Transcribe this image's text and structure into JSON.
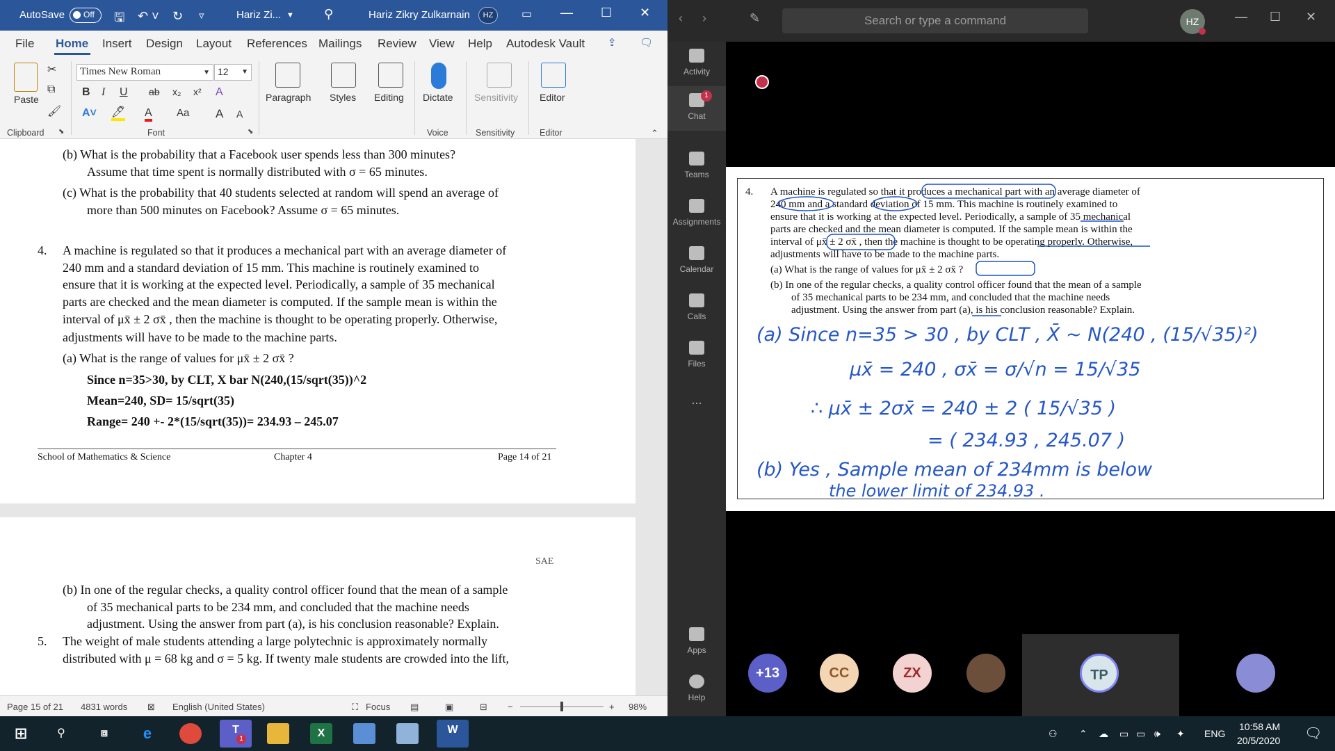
{
  "word": {
    "titlebar": {
      "autosave": "AutoSave",
      "autosave_state": "Off",
      "doc_title": "Hariz Zi...",
      "user_name": "Hariz Zikry Zulkarnain",
      "user_initials": "HZ"
    },
    "menu": [
      "File",
      "Home",
      "Insert",
      "Design",
      "Layout",
      "References",
      "Mailings",
      "Review",
      "View",
      "Help",
      "Autodesk Vault"
    ],
    "ribbon": {
      "paste": "Paste",
      "font_name": "Times New Roman",
      "font_size": "12",
      "paragraph": "Paragraph",
      "styles": "Styles",
      "editing": "Editing",
      "dictate": "Dictate",
      "sensitivity": "Sensitivity",
      "editor": "Editor",
      "group_clipboard": "Clipboard",
      "group_font": "Font",
      "group_voice": "Voice",
      "group_sensitivity": "Sensitivity",
      "group_editor": "Editor",
      "font_btns": [
        "B",
        "I",
        "U",
        "ab",
        "x₂",
        "x²",
        "A",
        "Aa",
        "A",
        "A"
      ]
    },
    "page1": {
      "line_b1": "(b)  What is the probability that a Facebook user spends less than 300 minutes?",
      "line_b2": "Assume that time spent is normally distributed with σ = 65 minutes.",
      "line_c1": "(c)  What is the probability that 40 students selected at random will spend an average of",
      "line_c2": "more than 500 minutes on Facebook?  Assume σ = 65 minutes.",
      "q4_num": "4.",
      "q4_lines": [
        "A machine is regulated so that it produces a mechanical part with an average diameter of",
        "240 mm and a standard deviation of 15 mm.  This machine is routinely examined to",
        "ensure that it is working at the expected level.  Periodically, a sample of 35 mechanical",
        "parts are checked and the mean diameter is computed.  If the sample mean is within the",
        "interval of μx̄ ± 2 σx̄ , then the machine is thought to be operating properly.  Otherwise,",
        "adjustments will have to be made to the machine parts."
      ],
      "q4a": "(a)  What is the range of values for μx̄ ± 2 σx̄ ?",
      "ans1": "Since n=35>30, by CLT, X bar N(240,(15/sqrt(35))^2",
      "ans2": "Mean=240, SD= 15/sqrt(35)",
      "ans3": "Range= 240 +- 2*(15/sqrt(35))= 234.93 – 245.07",
      "footer_left": "School of Mathematics & Science",
      "footer_mid": "Chapter 4",
      "footer_right": "Page 14 of 21"
    },
    "page2": {
      "header": "SAE",
      "b_lines": [
        "(b)  In one of the regular checks, a quality control officer found that the mean of a sample",
        "of 35 mechanical parts to be 234 mm, and concluded that the machine needs",
        "adjustment.  Using the answer from part (a), is his conclusion reasonable?  Explain."
      ],
      "q5_num": "5.",
      "q5_lines": [
        "The weight of male students attending a large polytechnic is approximately normally",
        "distributed with μ = 68 kg and σ = 5 kg.  If twenty male students are crowded into the lift,"
      ]
    },
    "status": {
      "page": "Page 15 of 21",
      "words": "4831 words",
      "language": "English (United States)",
      "focus": "Focus",
      "zoom": "98%"
    }
  },
  "teams": {
    "search_placeholder": "Search or type a command",
    "avatar": "HZ",
    "rail": [
      {
        "label": "Activity"
      },
      {
        "label": "Chat",
        "badge": "1"
      },
      {
        "label": "Teams"
      },
      {
        "label": "Assignments"
      },
      {
        "label": "Calendar"
      },
      {
        "label": "Calls"
      },
      {
        "label": "Files"
      },
      {
        "label": "..."
      },
      {
        "label": "Apps"
      },
      {
        "label": "Help"
      }
    ],
    "shared": {
      "q_num": "4.",
      "q_lines": [
        "A machine is regulated so that it produces a mechanical part with an average diameter of",
        "240 mm and a standard deviation of 15 mm.  This machine is routinely examined to",
        "ensure that it is working at the expected level.  Periodically, a sample of 35 mechanical",
        "parts are checked and the mean diameter is computed.  If the sample mean is within the",
        "interval of μx̄ ± 2 σx̄ , then the machine is thought to be operating properly.  Otherwise,",
        "adjustments will have to be made to the machine parts."
      ],
      "qa": "(a)  What is the range of values for μx̄ ± 2 σx̄ ?",
      "qb1": "(b)  In one of the regular checks, a quality control officer found that the mean of a sample",
      "qb2": "of 35 mechanical parts to be 234 mm, and concluded that the machine needs",
      "qb3": "adjustment.  Using the answer from part (a), is his conclusion reasonable?  Explain.",
      "hw1": "(a)  Since  n=35 > 30 , by CLT , X̄ ~ N(240 , (15/√35)²)",
      "hw2": "μx̄ = 240  ,  σx̄ = σ/√n = 15/√35",
      "hw3": "∴  μx̄ ± 2σx̄  =  240 ± 2 ( 15/√35 )",
      "hw4": "= ( 234.93 , 245.07 )",
      "hw5": "(b)  Yes , Sample mean of 234mm is below",
      "hw6": "the lower limit of 234.93 ."
    },
    "participants": [
      "+13",
      "CC",
      "ZX",
      "",
      "TP",
      ""
    ]
  },
  "taskbar": {
    "lang": "ENG",
    "time": "10:58 AM",
    "date": "20/5/2020",
    "teams_badge": "1"
  }
}
